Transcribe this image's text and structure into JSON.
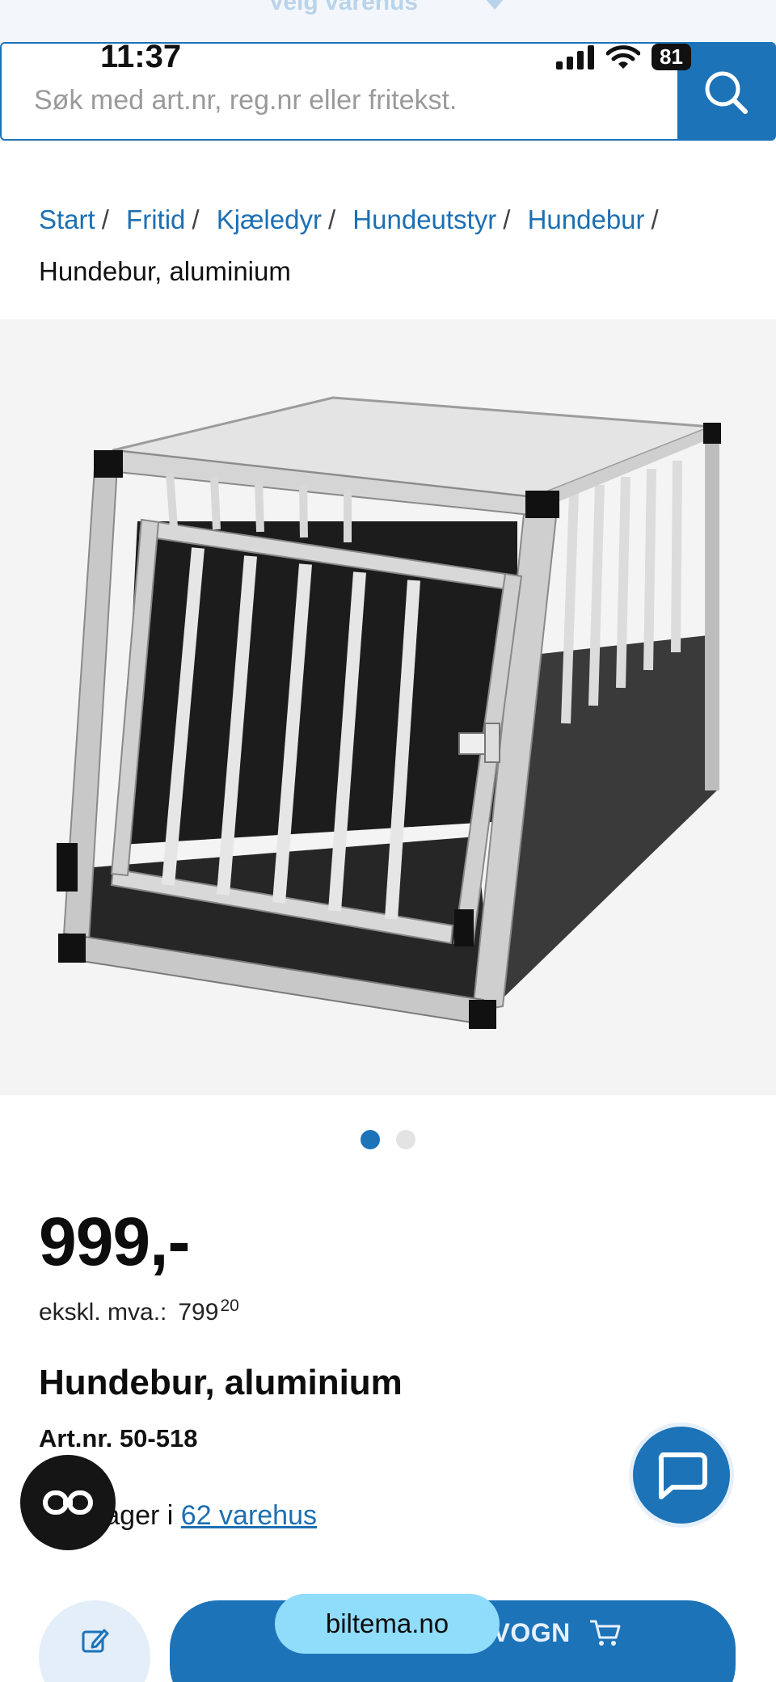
{
  "store_selector": {
    "label": "Velg varehus"
  },
  "status_bar": {
    "time": "11:37",
    "battery": "81"
  },
  "search": {
    "placeholder": "Søk med art.nr, reg.nr eller fritekst."
  },
  "breadcrumb": {
    "items": [
      "Start",
      "Fritid",
      "Kjæledyr",
      "Hundeutstyr",
      "Hundebur"
    ],
    "separator": "/",
    "current": "Hundebur, aluminium"
  },
  "carousel": {
    "total": 2,
    "active": 1
  },
  "product": {
    "price": "999,-",
    "vat_label": "ekskl. mva.:",
    "vat_value": "799",
    "vat_decimals": "20",
    "title": "Hundebur, aluminium",
    "article_number": "Art.nr. 50-518",
    "stock_prefix": "s på lager i",
    "stock_link": "62 varehus"
  },
  "actions": {
    "add_to_cart": "LEGG I HANDLEVOGN"
  },
  "browser": {
    "url": "biltema.no"
  },
  "colors": {
    "brand_blue": "#1d73b8",
    "link_blue": "#1d6fb3",
    "url_pill": "#8fdcfb"
  }
}
